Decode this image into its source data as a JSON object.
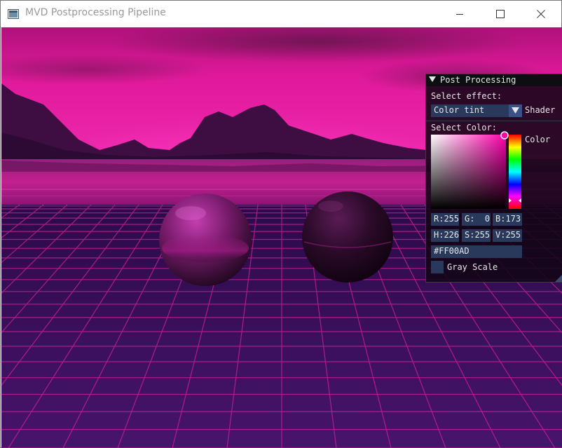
{
  "window": {
    "title": "MVD Postprocessing Pipeline",
    "controls": [
      "minimize",
      "maximize",
      "close"
    ]
  },
  "panel": {
    "title": "Post Processing",
    "select_effect_label": "Select effect:",
    "effect_value": "Color tint",
    "effect_combo_suffix": "Shader",
    "select_color_label": "Select Color:",
    "color_label": "Color",
    "rgb": {
      "r": "R:255",
      "g": "G:  0",
      "b": "B:173"
    },
    "hsv": {
      "h": "H:226",
      "s": "S:255",
      "v": "V:255"
    },
    "hex": "#FF00AD",
    "gray_scale_label": "Gray Scale",
    "gray_scale_checked": false
  },
  "colors": {
    "tint": "#FF00AD",
    "accent_button": "#3b5289",
    "frame_bg": "#29395c"
  }
}
